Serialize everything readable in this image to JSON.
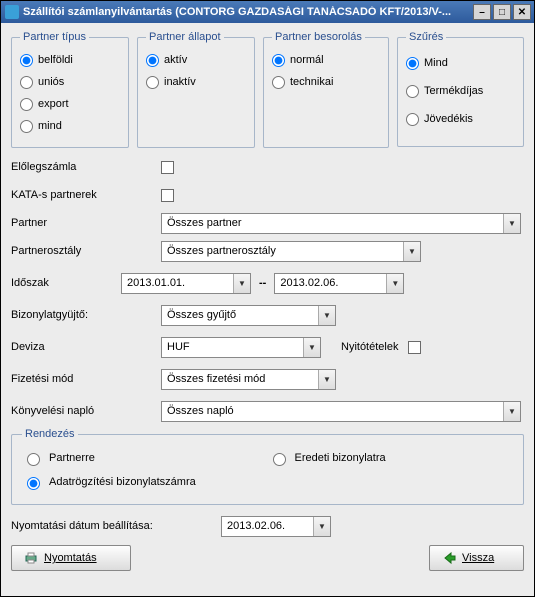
{
  "window": {
    "title": "Szállítói számlanyilvántartás (CONTORG GAZDASÁGI TANÁCSADÓ KFT/2013/V-..."
  },
  "groups": {
    "partnerTipus": {
      "legend": "Partner típus",
      "options": {
        "belfoldi": "belföldi",
        "unios": "uniós",
        "export": "export",
        "mind": "mind"
      }
    },
    "partnerAllapot": {
      "legend": "Partner állapot",
      "options": {
        "aktiv": "aktív",
        "inaktiv": "inaktív"
      }
    },
    "partnerBesorolas": {
      "legend": "Partner besorolás",
      "options": {
        "normal": "normál",
        "technikai": "technikai"
      }
    },
    "szures": {
      "legend": "Szűrés",
      "options": {
        "mind": "Mind",
        "termekdijas": "Termékdíjas",
        "jovedekis": "Jövedékis"
      }
    }
  },
  "checks": {
    "elolegszamla": "Előlegszámla",
    "katas": "KATA-s partnerek"
  },
  "labels": {
    "partner": "Partner",
    "partnerosztaly": "Partnerosztály",
    "idoszak": "Időszak",
    "bizonylatgyujto": "Bizonylatgyüjtő:",
    "deviza": "Deviza",
    "nyitotetelek": "Nyitótételek",
    "fizetesimod": "Fizetési mód",
    "konyvelesinaplo": "Könyvelési napló",
    "rendezes": "Rendezés",
    "nyomtatasidatum": "Nyomtatási dátum beállítása:"
  },
  "values": {
    "partner": "Összes partner",
    "partnerosztaly": "Összes partnerosztály",
    "idoszakFrom": "2013.01.01.",
    "idoszakTo": "2013.02.06.",
    "bizonylatgyujto": "Összes gyűjtő",
    "deviza": "HUF",
    "fizetesimod": "Összes fizetési mód",
    "konyvelesinaplo": "Összes napló",
    "nyomtatasidatum": "2013.02.06."
  },
  "sort": {
    "partnerre": "Partnerre",
    "eredeti": "Eredeti bizonylatra",
    "adatrogzitesi": "Adatrögzítési bizonylatszámra"
  },
  "buttons": {
    "nyomtatas": "Nyomtatás",
    "vissza": "Vissza"
  },
  "misc": {
    "dash": "--"
  }
}
